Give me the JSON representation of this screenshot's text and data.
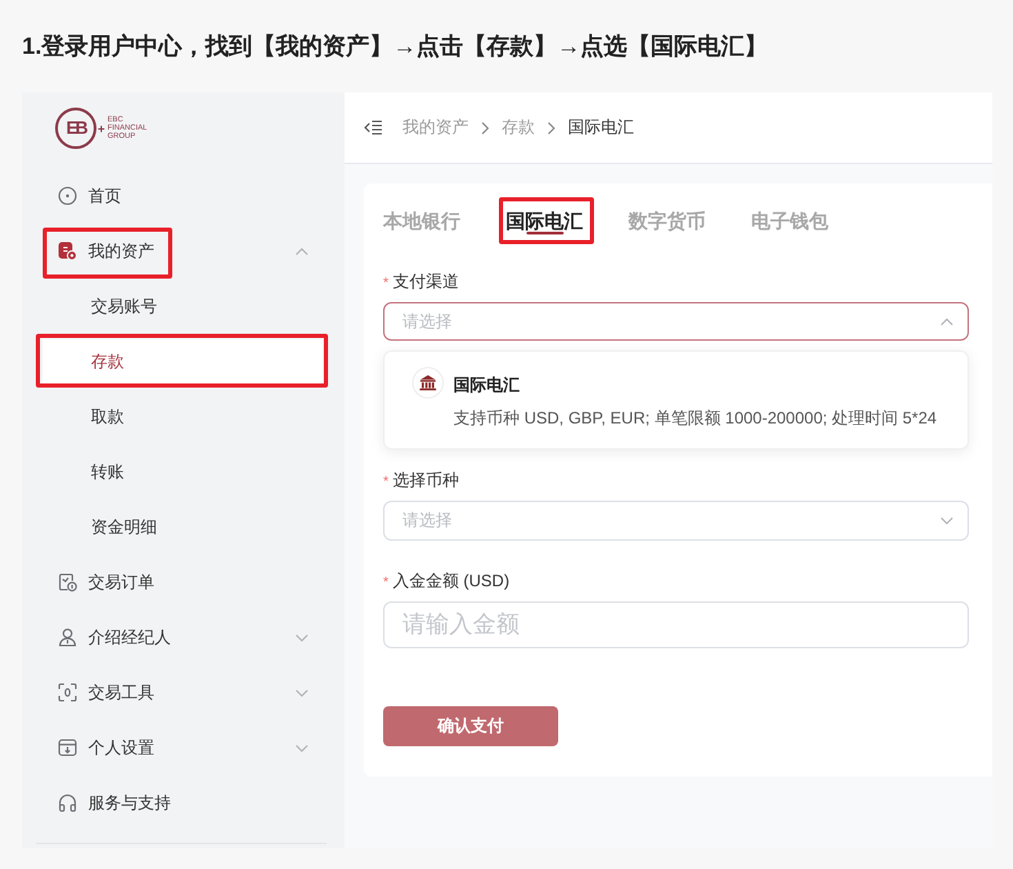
{
  "heading": "1.登录用户中心，找到【我的资产】→点击【存款】→点选【国际电汇】",
  "sidebar": {
    "logo": {
      "mark": "EB",
      "lines": [
        "EBC",
        "FINANCIAL",
        "GROUP"
      ]
    },
    "items": [
      {
        "kind": "link",
        "label": "首页",
        "selected": false,
        "highlighted": false
      },
      {
        "kind": "group",
        "label": "我的资产",
        "selected": false,
        "highlighted": true,
        "expanded": true,
        "children": [
          {
            "label": "交易账号",
            "selected": false,
            "highlighted": false
          },
          {
            "label": "存款",
            "selected": true,
            "highlighted": true
          },
          {
            "label": "取款",
            "selected": false,
            "highlighted": false
          },
          {
            "label": "转账",
            "selected": false,
            "highlighted": false
          },
          {
            "label": "资金明细",
            "selected": false,
            "highlighted": false
          }
        ]
      },
      {
        "kind": "link",
        "label": "交易订单",
        "selected": false,
        "highlighted": false
      },
      {
        "kind": "group",
        "label": "介绍经纪人",
        "selected": false,
        "highlighted": false,
        "expanded": false
      },
      {
        "kind": "group",
        "label": "交易工具",
        "selected": false,
        "highlighted": false,
        "expanded": false
      },
      {
        "kind": "group",
        "label": "个人设置",
        "selected": false,
        "highlighted": false,
        "expanded": false
      },
      {
        "kind": "link",
        "label": "服务与支持",
        "selected": false,
        "highlighted": false
      }
    ]
  },
  "breadcrumb": [
    "我的资产",
    "存款",
    "国际电汇"
  ],
  "tabs": [
    {
      "label": "本地银行",
      "selected": false,
      "highlighted": false
    },
    {
      "label": "国际电汇",
      "selected": true,
      "highlighted": true
    },
    {
      "label": "数字货币",
      "selected": false,
      "highlighted": false
    },
    {
      "label": "电子钱包",
      "selected": false,
      "highlighted": false
    }
  ],
  "form": {
    "fields": [
      {
        "kind": "select",
        "required_mark": "*",
        "label": "支付渠道",
        "placeholder": "请选择",
        "open": true,
        "options": [
          {
            "title": "国际电汇",
            "description": "支持币种 USD, GBP, EUR; 单笔限额 1000-200000; 处理时间 5*24"
          }
        ]
      },
      {
        "kind": "select",
        "required_mark": "*",
        "label": "选择币种",
        "placeholder": "请选择",
        "open": false
      },
      {
        "kind": "input",
        "required_mark": "*",
        "label": "入金金额 (USD)",
        "placeholder": "请输入金额"
      }
    ],
    "submit": "确认支付"
  }
}
